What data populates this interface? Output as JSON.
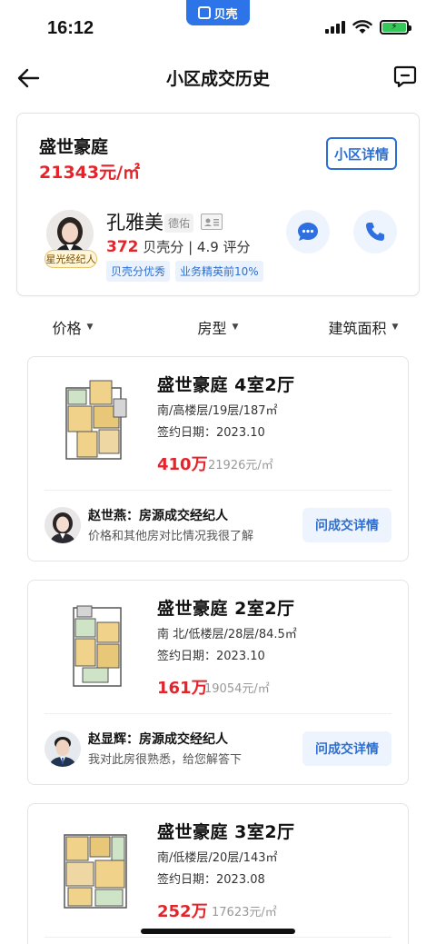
{
  "status_bar": {
    "time": "16:12",
    "app_badge": "贝壳"
  },
  "nav": {
    "title": "小区成交历史"
  },
  "community": {
    "name": "盛世豪庭",
    "price": "21343元/㎡",
    "detail_button": "小区详情"
  },
  "agent": {
    "badge": "星光经纪人",
    "name": "孔雅美",
    "company": "德佑",
    "score_value": "372",
    "score_label": "贝壳分",
    "rating": "| 4.9 评分",
    "tags": [
      "贝壳分优秀",
      "业务精英前10%"
    ]
  },
  "filters": [
    {
      "label": "价格"
    },
    {
      "label": "房型"
    },
    {
      "label": "建筑面积"
    }
  ],
  "listings": [
    {
      "title": "盛世豪庭 4室2厅",
      "info": "南/高楼层/19层/187㎡",
      "date": "签约日期：2023.10",
      "price": "410万",
      "unit_price": "21926元/㎡",
      "agent_name": "赵世燕：房源成交经纪人",
      "agent_msg": "价格和其他房对比情况我很了解",
      "ask_button": "问成交详情"
    },
    {
      "title": "盛世豪庭 2室2厅",
      "info": "南 北/低楼层/28层/84.5㎡",
      "date": "签约日期：2023.10",
      "price": "161万",
      "unit_price": "19054元/㎡",
      "agent_name": "赵显辉：房源成交经纪人",
      "agent_msg": "我对此房很熟悉，给您解答下",
      "ask_button": "问成交详情"
    },
    {
      "title": "盛世豪庭 3室2厅",
      "info": "南/低楼层/20层/143㎡",
      "date": "签约日期：2023.08",
      "price": "252万",
      "unit_price": "17623元/㎡"
    }
  ],
  "colors": {
    "accent_blue": "#2b6fd6",
    "price_red": "#e3242b",
    "tag_bg": "#eaf2fd"
  }
}
